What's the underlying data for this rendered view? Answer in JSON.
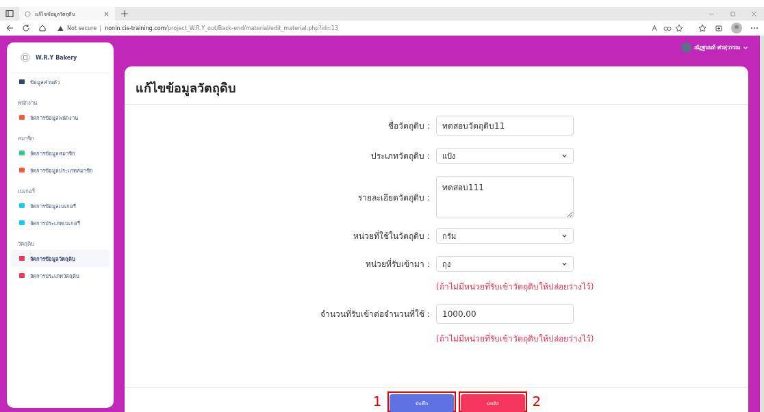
{
  "browser": {
    "tab_title": "แก้ไขข้อมูลวัตถุดิบ",
    "security": "Not secure",
    "url_host": "nonin.cis-training.com",
    "url_path": "/project_W.R.Y_out/Back-end/material/edit_material.php?id=13"
  },
  "sidebar": {
    "brand": "W.R.Y Bakery",
    "items": [
      {
        "kind": "item",
        "label": "ข้อมูลส่วนตัว",
        "color": "#344767",
        "selected": false
      },
      {
        "kind": "heading",
        "label": "พนักงาน"
      },
      {
        "kind": "item",
        "label": "จัดการข้อมูลพนักงาน",
        "color": "#f5593d",
        "selected": false
      },
      {
        "kind": "heading",
        "label": "สมาชิก"
      },
      {
        "kind": "item",
        "label": "จัดการข้อมูลสมาชิก",
        "color": "#2dce89",
        "selected": false
      },
      {
        "kind": "item",
        "label": "จัดการข้อมูลประเภทสมาชิก",
        "color": "#f5593d",
        "selected": false
      },
      {
        "kind": "heading",
        "label": "เบเกอรี่"
      },
      {
        "kind": "item",
        "label": "จัดการข้อมูลเบเกอรี่",
        "color": "#11cdef",
        "selected": false
      },
      {
        "kind": "item",
        "label": "จัดการประเภทเบเกอรี่",
        "color": "#11cdef",
        "selected": false
      },
      {
        "kind": "heading",
        "label": "วัตถุดิบ"
      },
      {
        "kind": "item",
        "label": "จัดการข้อมูลวัตถุดิบ",
        "color": "#f5365c",
        "selected": true
      },
      {
        "kind": "item",
        "label": "จัดการประเภทวัตถุดิบ",
        "color": "#f5365c",
        "selected": false
      }
    ]
  },
  "user": {
    "name": "ณัฏฐนนท์ ศรสุวรรณ"
  },
  "page_title": "แก้ไขข้อมูลวัตถุดิบ",
  "form": [
    {
      "kind": "input",
      "label": "ชื่อวัตถุดิบ :",
      "value": "ทดสอบวัตถุดิบ11"
    },
    {
      "kind": "select",
      "label": "ประเภทวัตถุดิบ :",
      "value": "แป้ง"
    },
    {
      "kind": "textarea",
      "label": "รายละเอียดวัตถุดิบ :",
      "value": "ทดสอบ111"
    },
    {
      "kind": "select",
      "label": "หน่วยที่ใช้ในวัตถุดิบ :",
      "value": "กรัม"
    },
    {
      "kind": "select",
      "label": "หน่วยที่รับเข้ามา :",
      "value": "ถุง"
    },
    {
      "kind": "hint",
      "label": "(ถ้าไม่มีหน่วยที่รับเข้าวัตถุดิบให้ปล่อยว่างไว้)"
    },
    {
      "kind": "input",
      "label": "จำนวนที่รับเข้าต่อจำนวนที่ใช้ :",
      "value": "1000.00"
    },
    {
      "kind": "hint",
      "label": "(ถ้าไม่มีหน่วยที่รับเข้าวัตถุดิบให้ปล่อยว่างไว้)"
    }
  ],
  "buttons": [
    {
      "label": "บันทึก",
      "kind": "save",
      "marker": "1"
    },
    {
      "label": "ยกเลิก",
      "kind": "cancel",
      "marker": "2"
    }
  ]
}
